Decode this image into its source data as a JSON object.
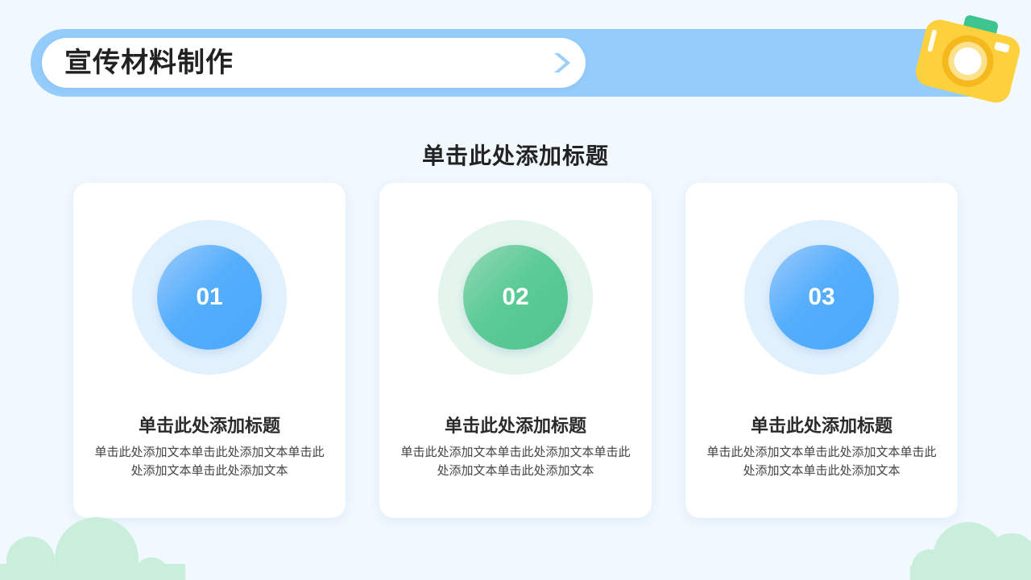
{
  "header": {
    "title": "宣传材料制作",
    "chevron_icon": "chevron-right-icon",
    "decoration_icon": "camera-icon"
  },
  "section": {
    "heading": "单击此处添加标题"
  },
  "cards": [
    {
      "number": "01",
      "title": "单击此处添加标题",
      "body": "单击此处添加文本单击此处添加文本单击此处添加文本单击此处添加文本",
      "accent": "#4aa8fb"
    },
    {
      "number": "02",
      "title": "单击此处添加标题",
      "body": "单击此处添加文本单击此处添加文本单击此处添加文本单击此处添加文本",
      "accent": "#52c48e"
    },
    {
      "number": "03",
      "title": "单击此处添加标题",
      "body": "单击此处添加文本单击此处添加文本单击此处添加文本单击此处添加文本",
      "accent": "#4aa8fb"
    }
  ],
  "colors": {
    "background": "#f1f8fe",
    "banner": "#94ccfb",
    "blue_accent": "#4aa8fb",
    "green_accent": "#52c48e",
    "camera_yellow": "#fdd13d",
    "cloud_green": "#c9eedb"
  }
}
